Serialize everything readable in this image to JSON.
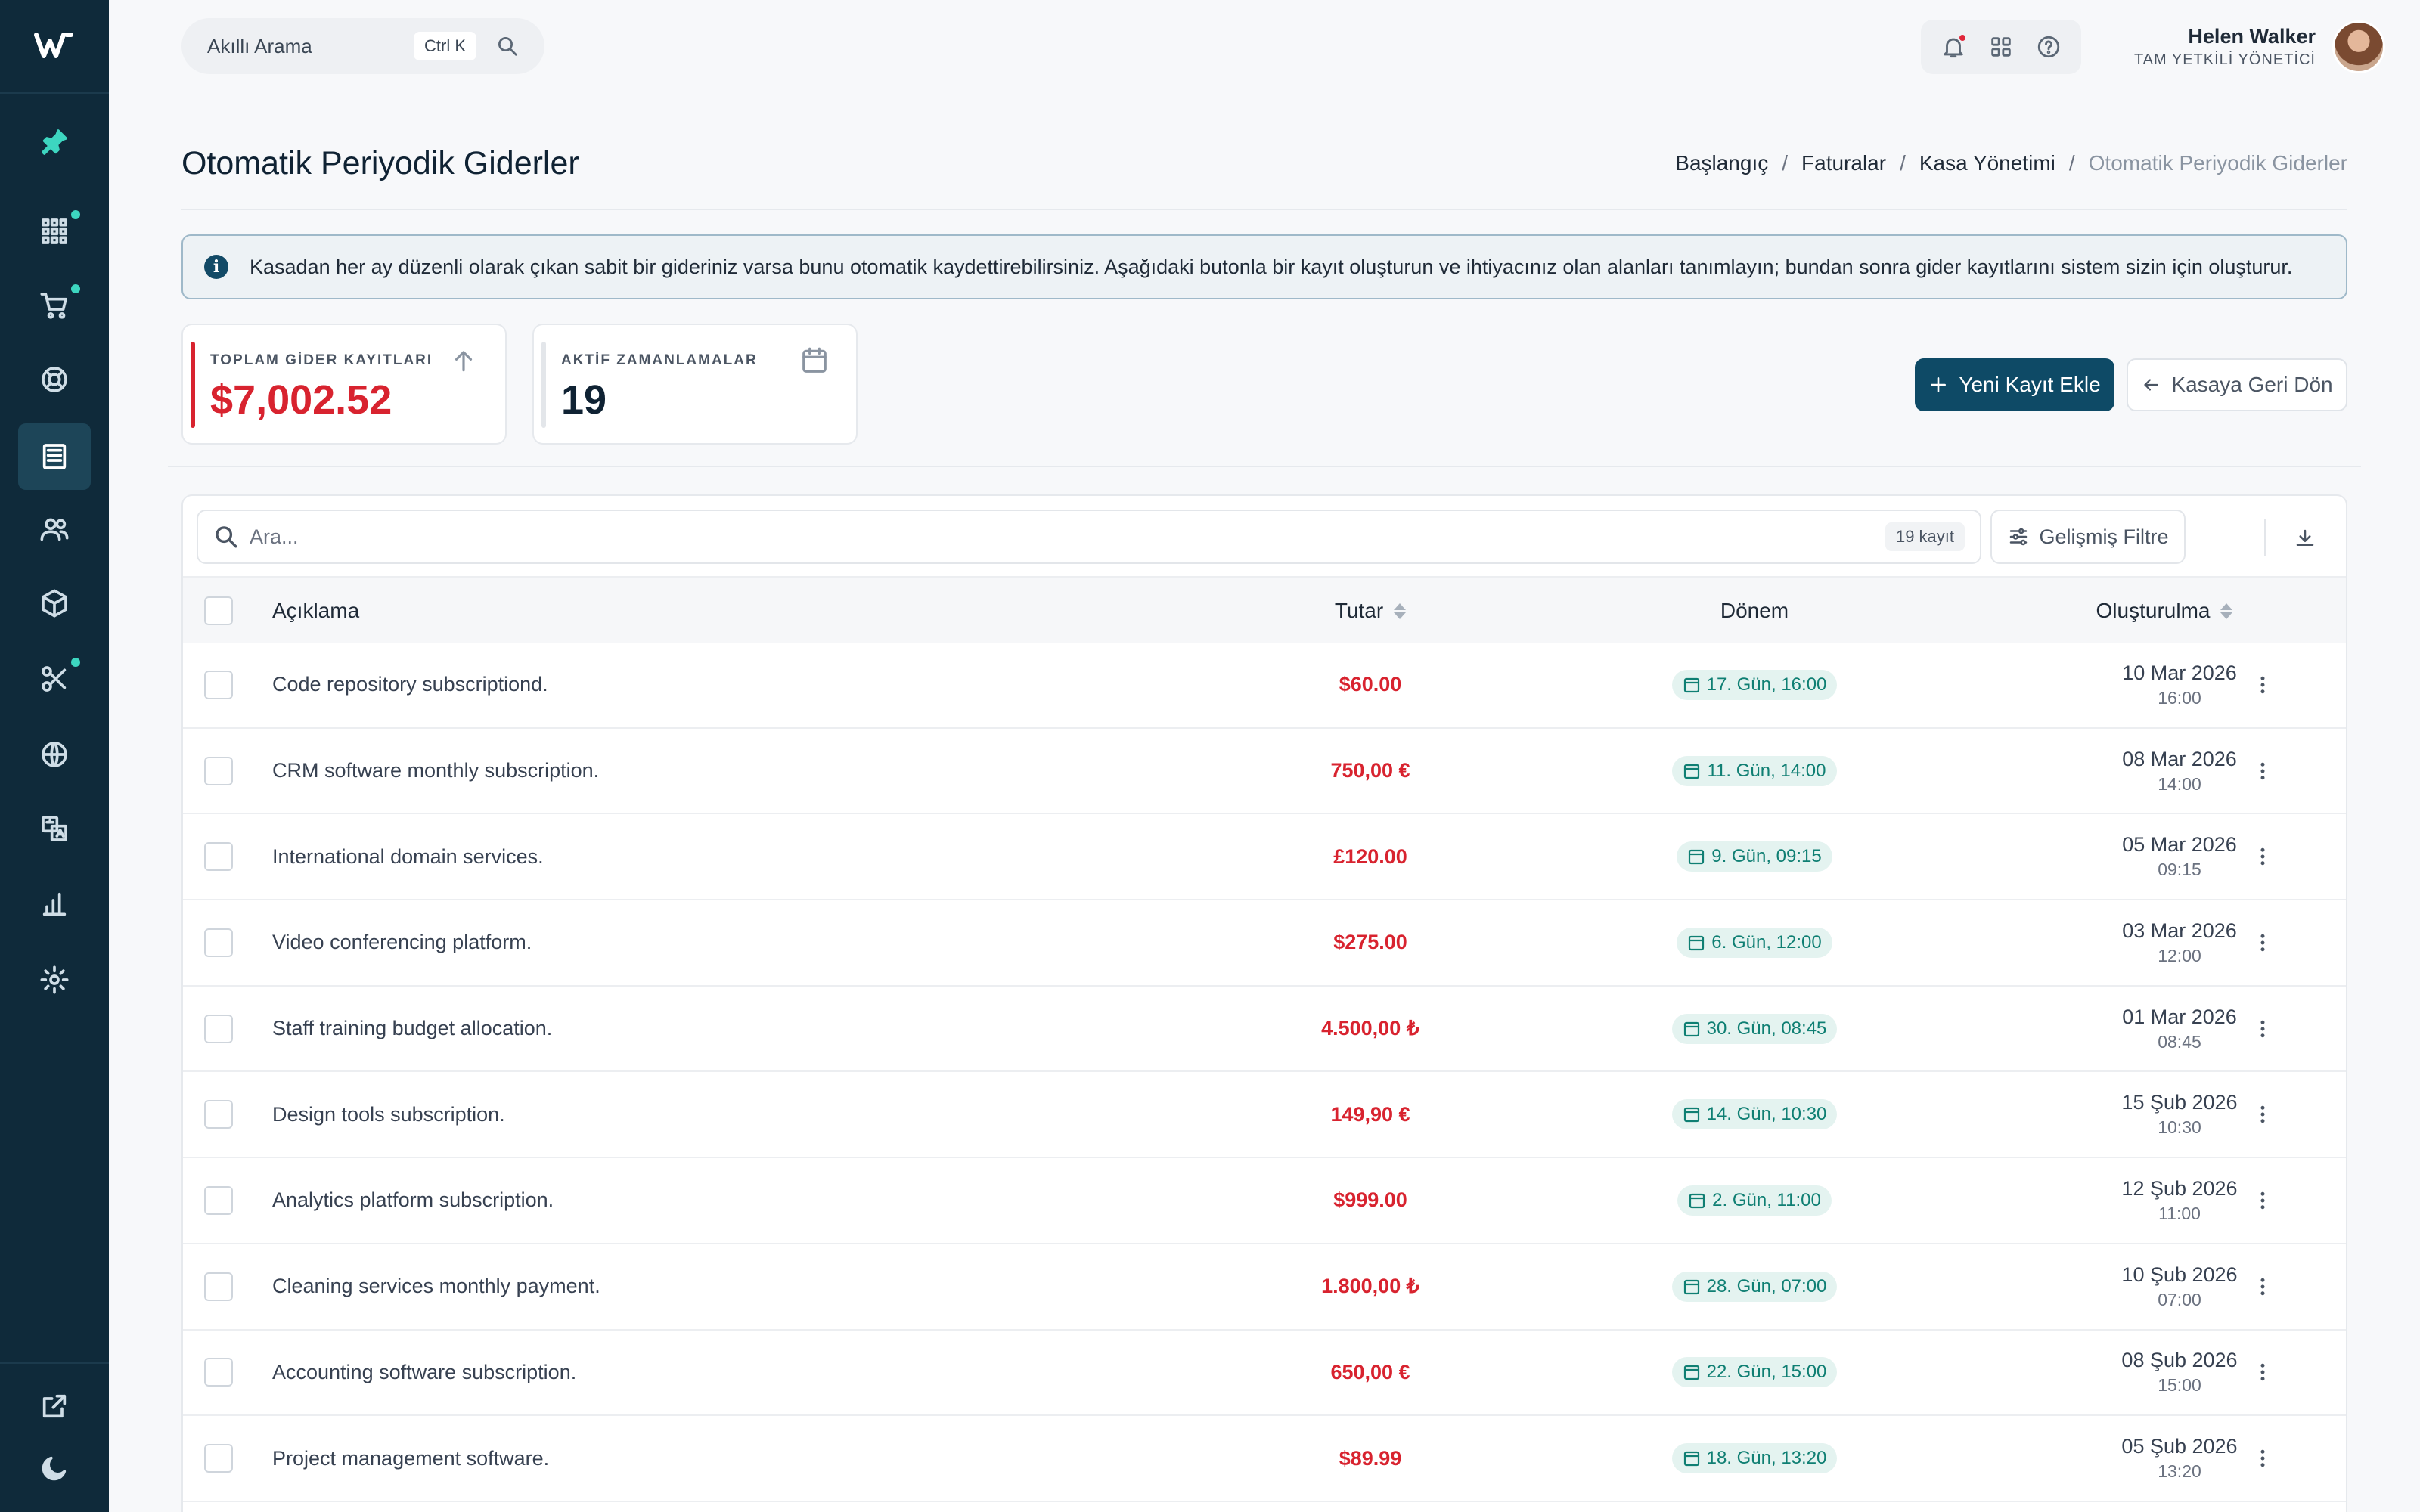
{
  "header": {
    "search_label": "Akıllı Arama",
    "search_shortcut": "Ctrl K",
    "user_name": "Helen Walker",
    "user_role": "TAM YETKİLİ YÖNETİCİ"
  },
  "page": {
    "title": "Otomatik Periyodik Giderler",
    "breadcrumb": [
      "Başlangıç",
      "Faturalar",
      "Kasa Yönetimi",
      "Otomatik Periyodik Giderler"
    ],
    "info": "Kasadan her ay düzenli olarak çıkan sabit bir gideriniz varsa bunu otomatik kaydettirebilirsiniz. Aşağıdaki butonla bir kayıt oluşturun ve ihtiyacınız olan alanları tanımlayın; bundan sonra gider kayıtlarını sistem sizin için oluşturur."
  },
  "stats": {
    "total_label": "TOPLAM GİDER KAYITLARI",
    "total_value": "$7,002.52",
    "active_label": "AKTİF ZAMANLAMALAR",
    "active_value": "19"
  },
  "actions": {
    "add_label": "Yeni Kayıt Ekle",
    "back_label": "Kasaya Geri Dön"
  },
  "table": {
    "search_placeholder": "Ara...",
    "record_count": "19 kayıt",
    "filter_label": "Gelişmiş Filtre",
    "columns": {
      "description": "Açıklama",
      "amount": "Tutar",
      "period": "Dönem",
      "created": "Oluşturulma"
    },
    "rows": [
      {
        "description": "Code repository subscriptiond.",
        "amount": "$60.00",
        "period": "17. Gün, 16:00",
        "date": "10 Mar 2026",
        "time": "16:00"
      },
      {
        "description": "CRM software monthly subscription.",
        "amount": "750,00 €",
        "period": "11. Gün, 14:00",
        "date": "08 Mar 2026",
        "time": "14:00"
      },
      {
        "description": "International domain services.",
        "amount": "£120.00",
        "period": "9. Gün, 09:15",
        "date": "05 Mar 2026",
        "time": "09:15"
      },
      {
        "description": "Video conferencing platform.",
        "amount": "$275.00",
        "period": "6. Gün, 12:00",
        "date": "03 Mar 2026",
        "time": "12:00"
      },
      {
        "description": "Staff training budget allocation.",
        "amount": "4.500,00 ₺",
        "period": "30. Gün, 08:45",
        "date": "01 Mar 2026",
        "time": "08:45"
      },
      {
        "description": "Design tools subscription.",
        "amount": "149,90 €",
        "period": "14. Gün, 10:30",
        "date": "15 Şub 2026",
        "time": "10:30"
      },
      {
        "description": "Analytics platform subscription.",
        "amount": "$999.00",
        "period": "2. Gün, 11:00",
        "date": "12 Şub 2026",
        "time": "11:00"
      },
      {
        "description": "Cleaning services monthly payment.",
        "amount": "1.800,00 ₺",
        "period": "28. Gün, 07:00",
        "date": "10 Şub 2026",
        "time": "07:00"
      },
      {
        "description": "Accounting software subscription.",
        "amount": "650,00 €",
        "period": "22. Gün, 15:00",
        "date": "08 Şub 2026",
        "time": "15:00"
      },
      {
        "description": "Project management software.",
        "amount": "$89.99",
        "period": "18. Gün, 13:20",
        "date": "05 Şub 2026",
        "time": "13:20"
      }
    ]
  },
  "colors": {
    "sidebar": "#0f2a3a",
    "primary": "#0e4a66",
    "danger": "#d8232f",
    "teal": "#0f7f73"
  }
}
